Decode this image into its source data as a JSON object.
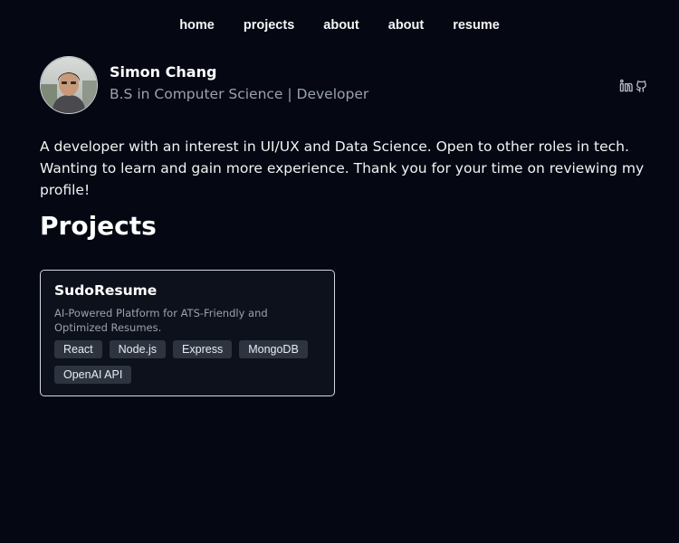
{
  "nav": {
    "items": [
      {
        "label": "home"
      },
      {
        "label": "projects"
      },
      {
        "label": "about"
      },
      {
        "label": "about"
      },
      {
        "label": "resume"
      }
    ]
  },
  "profile": {
    "name": "Simon Chang",
    "subtitle": "B.S in Computer Science | Developer",
    "socials": [
      {
        "icon": "linkedin-icon"
      },
      {
        "icon": "github-icon"
      }
    ]
  },
  "bio": "A developer with an interest in UI/UX and Data Science. Open to other roles in tech. Wanting to learn and gain more experience. Thank you for your time on reviewing my profile!",
  "projects": {
    "title": "Projects",
    "cards": [
      {
        "title": "SudoResume",
        "description": "AI-Powered Platform for ATS-Friendly and Optimized Resumes.",
        "tags": [
          "React",
          "Node.js",
          "Express",
          "MongoDB",
          "OpenAI API"
        ]
      }
    ]
  },
  "colors": {
    "background": "#050812",
    "card_background": "#0c111b",
    "tag_background": "#2d3440",
    "muted_text": "#9aa2ad"
  }
}
